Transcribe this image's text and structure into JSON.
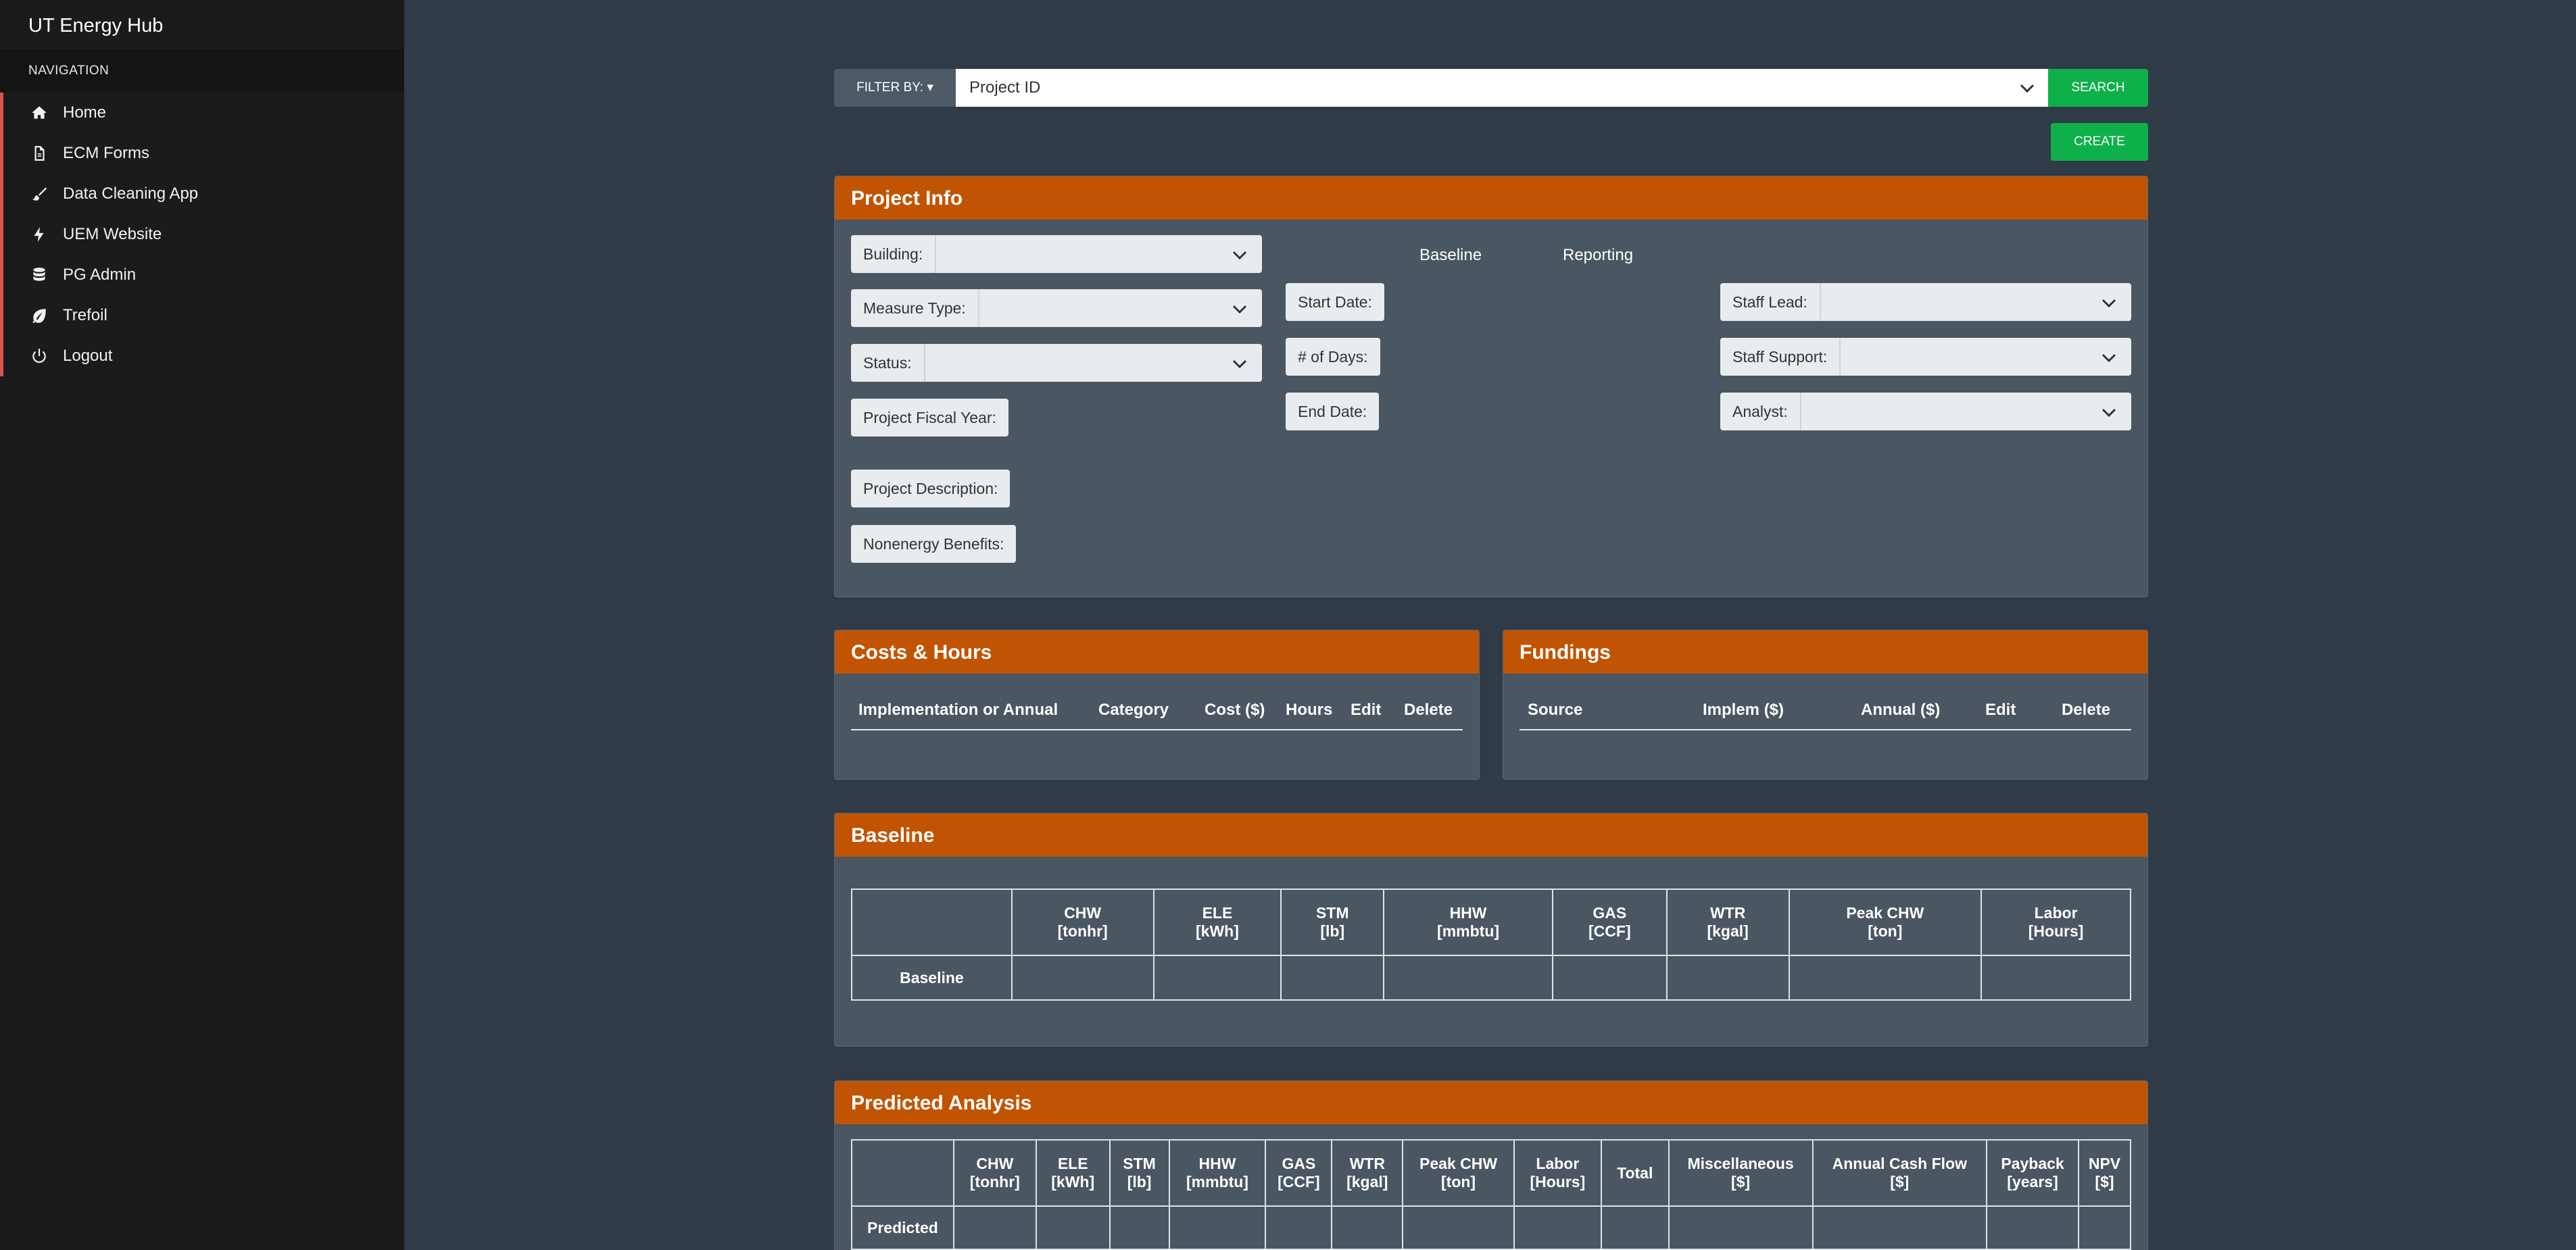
{
  "sidebar": {
    "brand": "UT Energy Hub",
    "nav_heading": "NAVIGATION",
    "items": [
      {
        "label": "Home",
        "icon": "home-icon"
      },
      {
        "label": "ECM Forms",
        "icon": "document-icon"
      },
      {
        "label": "Data Cleaning App",
        "icon": "brush-icon"
      },
      {
        "label": "UEM Website",
        "icon": "bolt-icon"
      },
      {
        "label": "PG Admin",
        "icon": "database-icon"
      },
      {
        "label": "Trefoil",
        "icon": "leaf-icon"
      },
      {
        "label": "Logout",
        "icon": "power-icon"
      }
    ]
  },
  "toolbar": {
    "filter_label": "FILTER BY: ▾",
    "filter_value": "Project ID",
    "search_label": "SEARCH",
    "create_label": "CREATE"
  },
  "project_info": {
    "title": "Project Info",
    "building": "Building:",
    "measure_type": "Measure Type:",
    "status": "Status:",
    "fiscal_year": "Project Fiscal Year:",
    "description": "Project Description:",
    "nonenergy": "Nonenergy Benefits:",
    "col_baseline": "Baseline",
    "col_reporting": "Reporting",
    "start_date": "Start Date:",
    "num_days": "# of Days:",
    "end_date": "End Date:",
    "staff_lead": "Staff Lead:",
    "staff_support": "Staff Support:",
    "analyst": "Analyst:"
  },
  "costs": {
    "title": "Costs & Hours",
    "columns": [
      "Implementation or Annual",
      "Category",
      "Cost ($)",
      "Hours",
      "Edit",
      "Delete"
    ]
  },
  "fundings": {
    "title": "Fundings",
    "columns": [
      "Source",
      "Implem ($)",
      "Annual ($)",
      "Edit",
      "Delete"
    ]
  },
  "baseline": {
    "title": "Baseline",
    "columns": [
      {
        "name": "CHW",
        "unit": "[tonhr]"
      },
      {
        "name": "ELE",
        "unit": "[kWh]"
      },
      {
        "name": "STM",
        "unit": "[lb]"
      },
      {
        "name": "HHW",
        "unit": "[mmbtu]"
      },
      {
        "name": "GAS",
        "unit": "[CCF]"
      },
      {
        "name": "WTR",
        "unit": "[kgal]"
      },
      {
        "name": "Peak CHW",
        "unit": "[ton]"
      },
      {
        "name": "Labor",
        "unit": "[Hours]"
      }
    ],
    "row_label": "Baseline"
  },
  "predicted": {
    "title": "Predicted Analysis",
    "columns": [
      {
        "name": "CHW",
        "unit": "[tonhr]"
      },
      {
        "name": "ELE",
        "unit": "[kWh]"
      },
      {
        "name": "STM",
        "unit": "[lb]"
      },
      {
        "name": "HHW",
        "unit": "[mmbtu]"
      },
      {
        "name": "GAS",
        "unit": "[CCF]"
      },
      {
        "name": "WTR",
        "unit": "[kgal]"
      },
      {
        "name": "Peak CHW",
        "unit": "[ton]"
      },
      {
        "name": "Labor",
        "unit": "[Hours]"
      }
    ],
    "extra_columns": [
      {
        "name": "Total",
        "unit": ""
      },
      {
        "name": "Miscellaneous",
        "unit": "[$]"
      },
      {
        "name": "Annual Cash Flow",
        "unit": "[$]"
      },
      {
        "name": "Payback",
        "unit": "[years]"
      },
      {
        "name": "NPV",
        "unit": "[$]"
      }
    ],
    "row_label": "Predicted"
  },
  "colors": {
    "sidebar_bg": "#1b1b1b",
    "main_bg": "#2f3c48",
    "card_bg": "#4a5661",
    "header_orange": "#c15402",
    "button_green": "#0eb04a",
    "nav_accent": "#d9534f"
  }
}
